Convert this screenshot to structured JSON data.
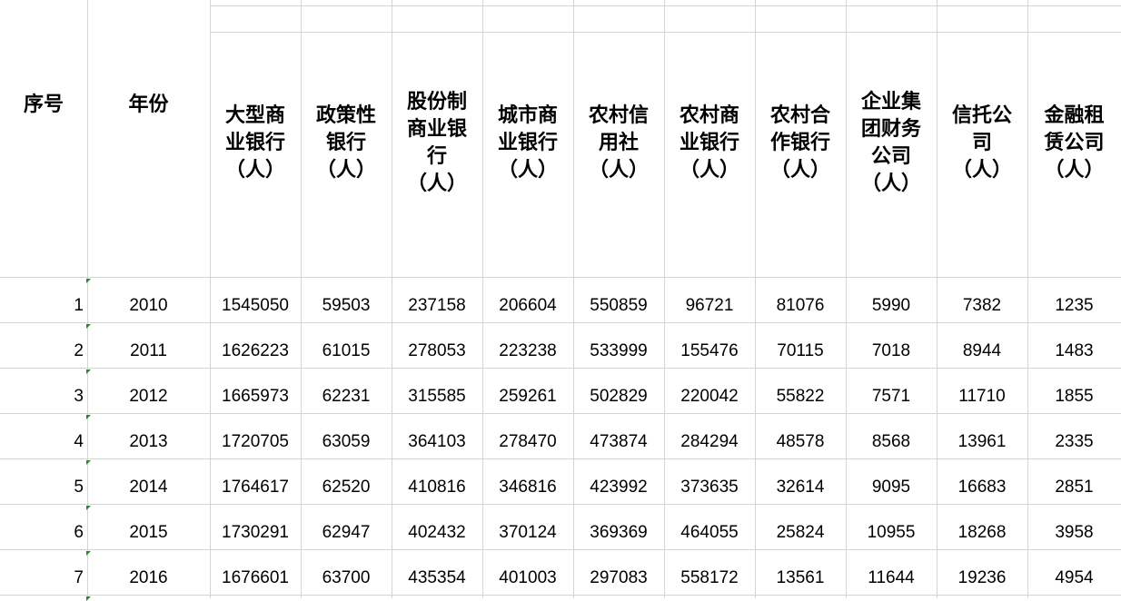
{
  "header": {
    "index_label": "序号",
    "year_label": "年份",
    "columns": [
      "大型商\n业银行\n（人）",
      "政策性\n银行\n（人）",
      "股份制\n商业银\n行\n（人）",
      "城市商\n业银行\n（人）",
      "农村信\n用社\n（人）",
      "农村商\n业银行\n（人）",
      "农村合\n作银行\n（人）",
      "企业集\n团财务\n公司\n（人）",
      "信托公\n司\n（人）",
      "金融租\n赁公司\n（人）"
    ]
  },
  "rows": [
    {
      "index": "1",
      "year": "2010",
      "values": [
        "1545050",
        "59503",
        "237158",
        "206604",
        "550859",
        "96721",
        "81076",
        "5990",
        "7382",
        "1235"
      ]
    },
    {
      "index": "2",
      "year": "2011",
      "values": [
        "1626223",
        "61015",
        "278053",
        "223238",
        "533999",
        "155476",
        "70115",
        "7018",
        "8944",
        "1483"
      ]
    },
    {
      "index": "3",
      "year": "2012",
      "values": [
        "1665973",
        "62231",
        "315585",
        "259261",
        "502829",
        "220042",
        "55822",
        "7571",
        "11710",
        "1855"
      ]
    },
    {
      "index": "4",
      "year": "2013",
      "values": [
        "1720705",
        "63059",
        "364103",
        "278470",
        "473874",
        "284294",
        "48578",
        "8568",
        "13961",
        "2335"
      ]
    },
    {
      "index": "5",
      "year": "2014",
      "values": [
        "1764617",
        "62520",
        "410816",
        "346816",
        "423992",
        "373635",
        "32614",
        "9095",
        "16683",
        "2851"
      ]
    },
    {
      "index": "6",
      "year": "2015",
      "values": [
        "1730291",
        "62947",
        "402432",
        "370124",
        "369369",
        "464055",
        "25824",
        "10955",
        "18268",
        "3958"
      ]
    },
    {
      "index": "7",
      "year": "2016",
      "values": [
        "1676601",
        "63700",
        "435354",
        "401003",
        "297083",
        "558172",
        "13561",
        "11644",
        "19236",
        "4954"
      ]
    }
  ],
  "colors": {
    "gridline": "#d4d4d4",
    "text_indicator": "#1e8a2e"
  }
}
